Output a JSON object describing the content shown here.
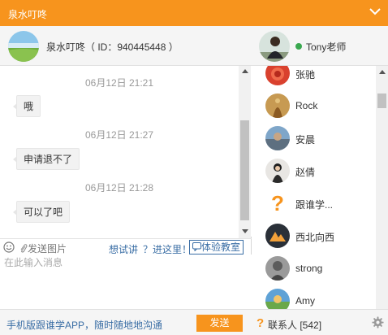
{
  "window": {
    "title": "泉水叮咚",
    "collapse_icon": "chevron-down-icon",
    "accent_color": "#f7941d"
  },
  "chat": {
    "header": {
      "name": "泉水叮咚（ ID：940445448 ）"
    },
    "messages": [
      {
        "time": "06月12日 21:21",
        "text": "哦"
      },
      {
        "time": "06月12日 21:27",
        "text": "申请退不了"
      },
      {
        "time": "06月12日 21:28",
        "text": "可以了吧"
      }
    ]
  },
  "toolbar": {
    "emoji_icon": "smiley-icon",
    "send_image_label": "发送图片",
    "try_label": "想试讲",
    "enter_label": "？进这里！",
    "experience_label": "体验教室"
  },
  "input": {
    "placeholder": "在此输入消息"
  },
  "footer": {
    "promo": "手机版跟谁学APP，随时随地地沟通",
    "send_label": "发送"
  },
  "teacher": {
    "name": "Tony老师",
    "status_color": "#3aa84f"
  },
  "contacts": [
    {
      "name": "张驰"
    },
    {
      "name": "Rock"
    },
    {
      "name": "安晨"
    },
    {
      "name": "赵倩"
    },
    {
      "name": "跟谁学..."
    },
    {
      "name": "西北向西"
    },
    {
      "name": "strong"
    },
    {
      "name": "Amy"
    }
  ],
  "contacts_footer": {
    "label": "联系人 [542]",
    "help_icon": "question-icon",
    "settings_icon": "gear-icon"
  }
}
